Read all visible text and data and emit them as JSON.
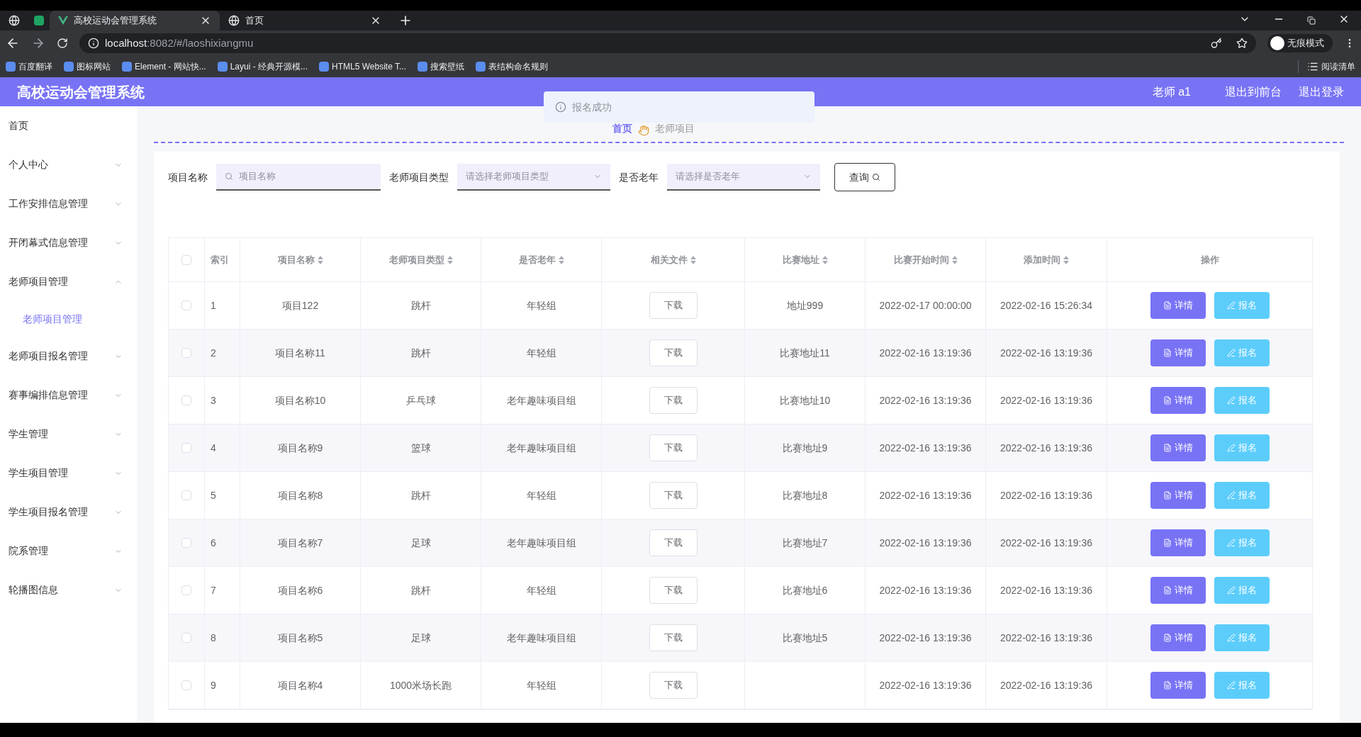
{
  "browser": {
    "tabs": [
      {
        "title": "高校运动会管理系统",
        "selected": true
      },
      {
        "title": "首页",
        "selected": false
      }
    ],
    "url_host": "localhost",
    "url_path": ":8082/#/laoshixiangmu",
    "profile": "无痕模式",
    "bookmarks": [
      "百度翻译",
      "图标网站",
      "Element - 网站快...",
      "Layui - 经典开源模...",
      "HTML5 Website T...",
      "搜索壁纸",
      "表结构命名规则"
    ],
    "reading_list": "阅读清单"
  },
  "header": {
    "title": "高校运动会管理系统",
    "user": "老师 a1",
    "links": [
      "退出到前台",
      "退出登录"
    ]
  },
  "toast": {
    "message": "报名成功"
  },
  "sidebar": {
    "items": [
      {
        "label": "首页"
      },
      {
        "label": "个人中心",
        "expanded": false
      },
      {
        "label": "工作安排信息管理",
        "expanded": false
      },
      {
        "label": "开闭幕式信息管理",
        "expanded": false
      },
      {
        "label": "老师项目管理",
        "expanded": true,
        "children": [
          {
            "label": "老师项目管理",
            "selected": true
          }
        ]
      },
      {
        "label": "老师项目报名管理",
        "expanded": false
      },
      {
        "label": "赛事编排信息管理",
        "expanded": false
      },
      {
        "label": "学生管理",
        "expanded": false
      },
      {
        "label": "学生项目管理",
        "expanded": false
      },
      {
        "label": "学生项目报名管理",
        "expanded": false
      },
      {
        "label": "院系管理",
        "expanded": false
      },
      {
        "label": "轮播图信息",
        "expanded": false
      }
    ]
  },
  "breadcrumb": [
    "首页",
    "老师项目"
  ],
  "filters": [
    {
      "kind": "search",
      "label": "项目名称",
      "placeholder": "项目名称"
    },
    {
      "kind": "select",
      "label": "老师项目类型",
      "placeholder": "请选择老师项目类型"
    },
    {
      "kind": "select",
      "label": "是否老年",
      "placeholder": "请选择是否老年"
    }
  ],
  "query_button": "查询",
  "table": {
    "columns": [
      "索引",
      "项目名称",
      "老师项目类型",
      "是否老年",
      "相关文件",
      "比赛地址",
      "比赛开始时间",
      "添加时间",
      "操作"
    ],
    "sortable": [
      false,
      true,
      true,
      true,
      true,
      true,
      true,
      true,
      false
    ],
    "rows": [
      {
        "index": "1",
        "name": "项目122",
        "type": "跳杆",
        "group": "年轻组",
        "file": "下载",
        "address": "地址999",
        "start": "2022-02-17 00:00:00",
        "added": "2022-02-16 15:26:34",
        "checked": false,
        "actions": [
          "详情",
          "报名"
        ]
      },
      {
        "index": "2",
        "name": "项目名称11",
        "type": "跳杆",
        "group": "年轻组",
        "file": "下载",
        "address": "比赛地址11",
        "start": "2022-02-16 13:19:36",
        "added": "2022-02-16 13:19:36",
        "checked": false,
        "actions": [
          "详情",
          "报名"
        ]
      },
      {
        "index": "3",
        "name": "项目名称10",
        "type": "乒乓球",
        "group": "老年趣味项目组",
        "file": "下载",
        "address": "比赛地址10",
        "start": "2022-02-16 13:19:36",
        "added": "2022-02-16 13:19:36",
        "checked": false,
        "actions": [
          "详情",
          "报名"
        ]
      },
      {
        "index": "4",
        "name": "项目名称9",
        "type": "篮球",
        "group": "老年趣味项目组",
        "file": "下载",
        "address": "比赛地址9",
        "start": "2022-02-16 13:19:36",
        "added": "2022-02-16 13:19:36",
        "checked": false,
        "actions": [
          "详情",
          "报名"
        ]
      },
      {
        "index": "5",
        "name": "项目名称8",
        "type": "跳杆",
        "group": "年轻组",
        "file": "下载",
        "address": "比赛地址8",
        "start": "2022-02-16 13:19:36",
        "added": "2022-02-16 13:19:36",
        "checked": false,
        "actions": [
          "详情",
          "报名"
        ]
      },
      {
        "index": "6",
        "name": "项目名称7",
        "type": "足球",
        "group": "老年趣味项目组",
        "file": "下载",
        "address": "比赛地址7",
        "start": "2022-02-16 13:19:36",
        "added": "2022-02-16 13:19:36",
        "checked": false,
        "actions": [
          "详情",
          "报名"
        ]
      },
      {
        "index": "7",
        "name": "项目名称6",
        "type": "跳杆",
        "group": "年轻组",
        "file": "下载",
        "address": "比赛地址6",
        "start": "2022-02-16 13:19:36",
        "added": "2022-02-16 13:19:36",
        "checked": false,
        "actions": [
          "详情",
          "报名"
        ]
      },
      {
        "index": "8",
        "name": "项目名称5",
        "type": "足球",
        "group": "老年趣味项目组",
        "file": "下载",
        "address": "比赛地址5",
        "start": "2022-02-16 13:19:36",
        "added": "2022-02-16 13:19:36",
        "checked": false,
        "actions": [
          "详情",
          "报名"
        ]
      },
      {
        "index": "9",
        "name": "项目名称4",
        "type": "1000米场长跑",
        "group": "年轻组",
        "file": "下载",
        "start": "2022-02-16 13:19:36",
        "added": "2022-02-16 13:19:36",
        "checked": false,
        "actions": [
          "详情",
          "报名"
        ]
      }
    ],
    "select_all_checked": false
  }
}
